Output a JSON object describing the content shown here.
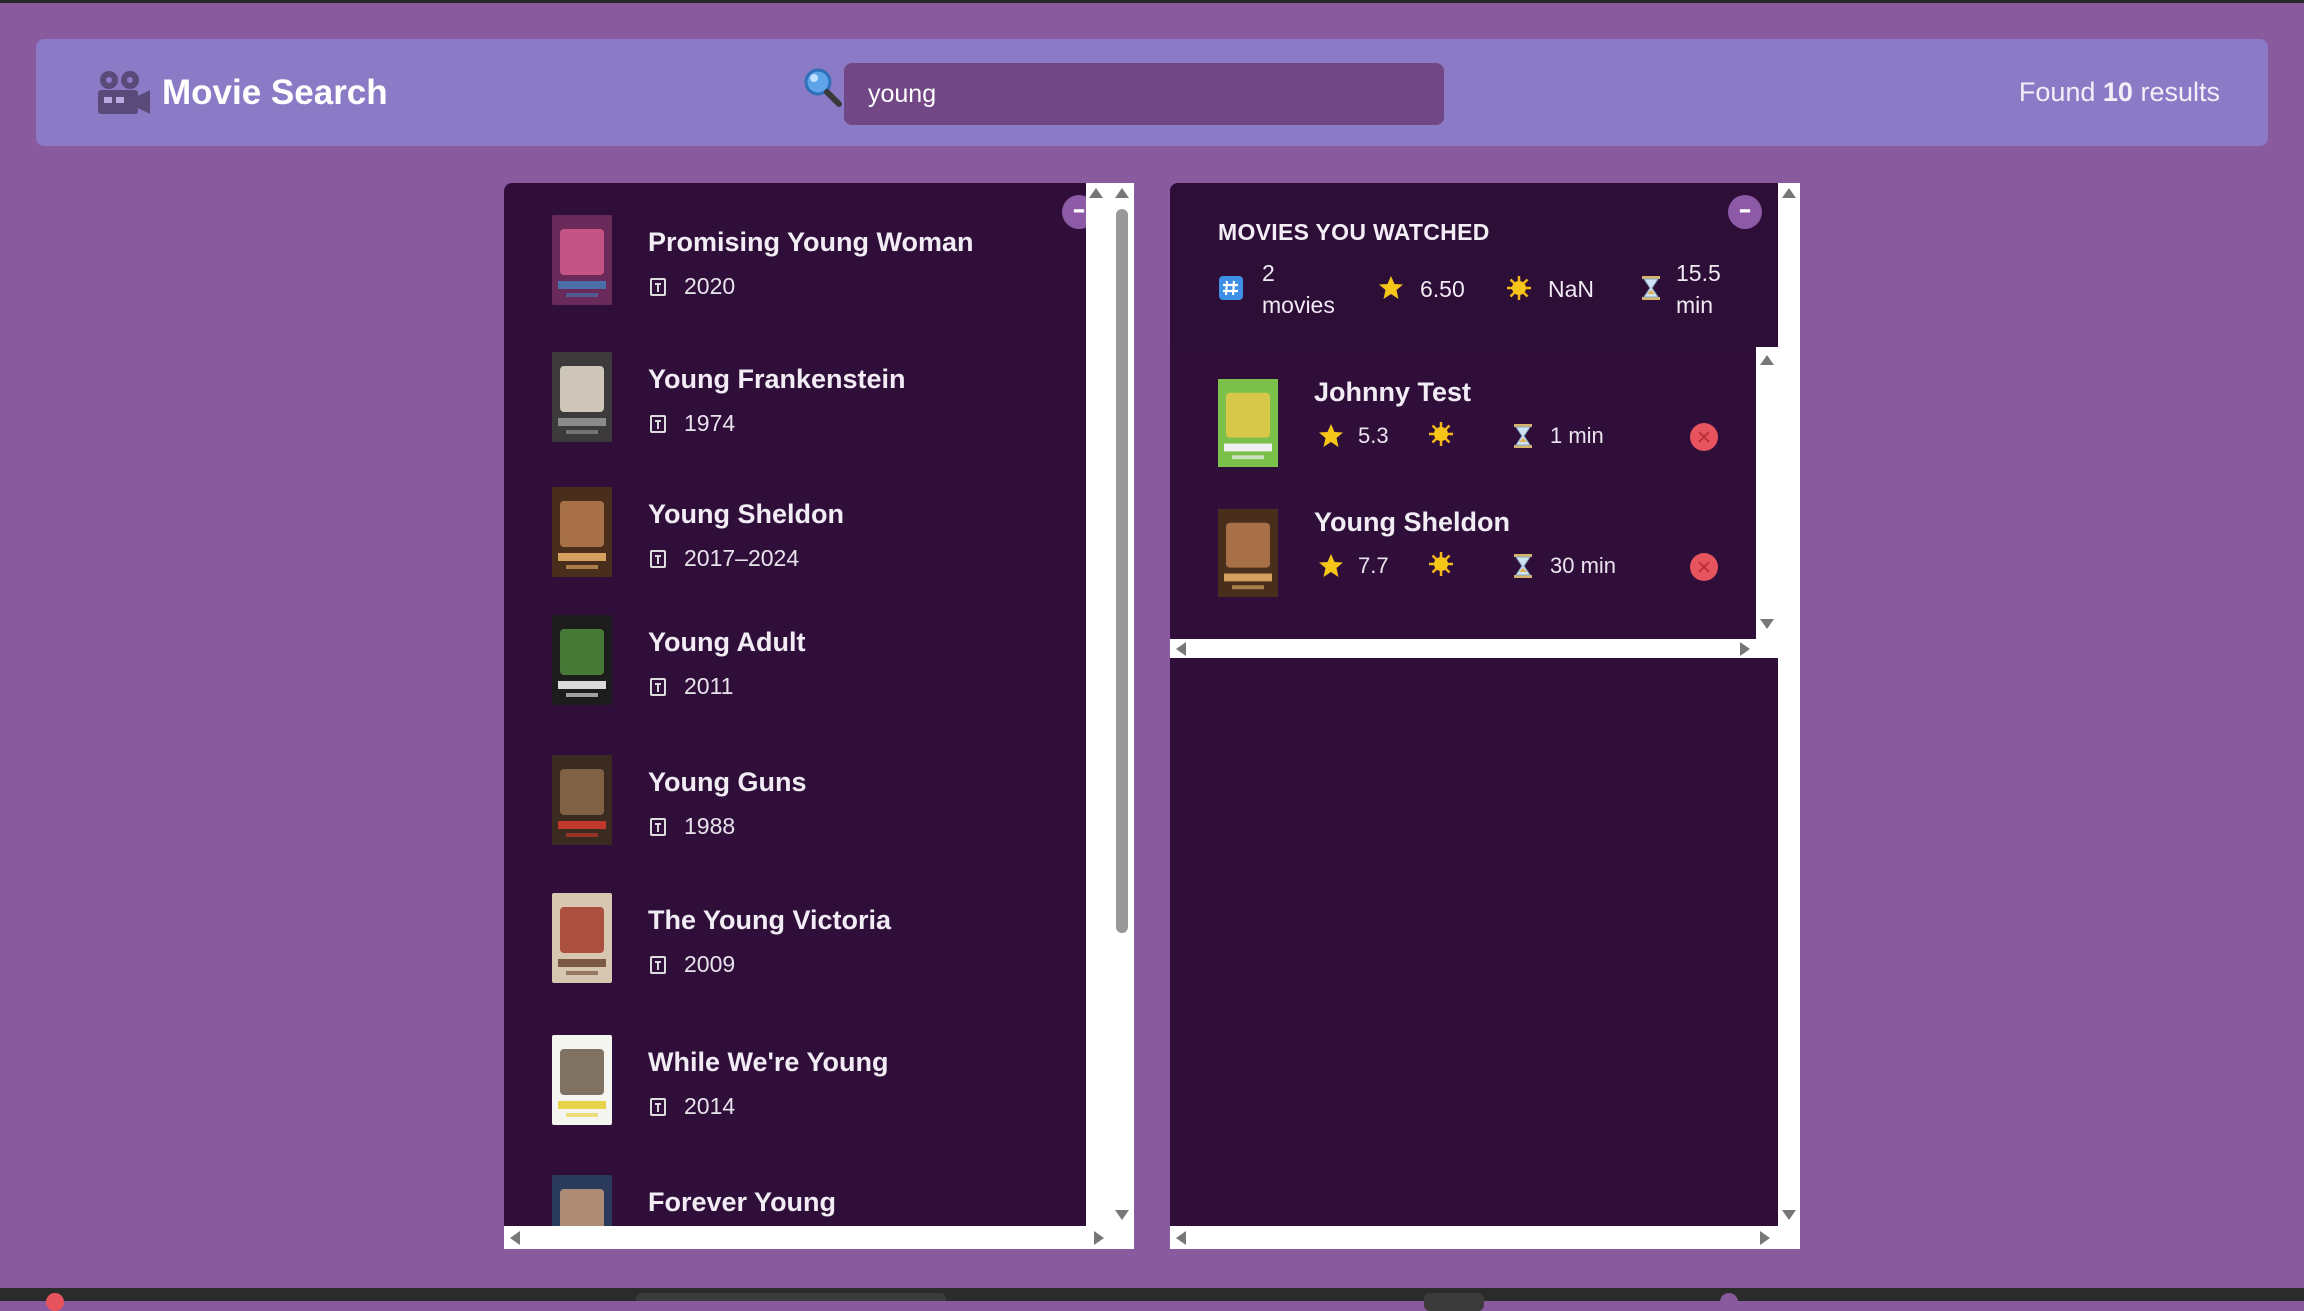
{
  "header": {
    "title": "Movie Search",
    "search_value": "young",
    "results_prefix": "Found",
    "results_count": "10",
    "results_suffix": "results"
  },
  "movies": [
    {
      "title": "Promising Young Woman",
      "year": "2020",
      "poster_colors": [
        "#6b2b5a",
        "#d45c8c",
        "#4a6fa8"
      ]
    },
    {
      "title": "Young Frankenstein",
      "year": "1974",
      "poster_colors": [
        "#3c3a3a",
        "#e8e0d0",
        "#8b8b8b"
      ]
    },
    {
      "title": "Young Sheldon",
      "year": "2017–2024",
      "poster_colors": [
        "#4a2e1c",
        "#b97b4f",
        "#d4a060"
      ]
    },
    {
      "title": "Young Adult",
      "year": "2011",
      "poster_colors": [
        "#1c1c1c",
        "#4c8a3a",
        "#d9d9d9"
      ]
    },
    {
      "title": "Young Guns",
      "year": "1988",
      "poster_colors": [
        "#3a2a1f",
        "#8d6b4a",
        "#c0392b"
      ]
    },
    {
      "title": "The Young Victoria",
      "year": "2009",
      "poster_colors": [
        "#d8c7b0",
        "#a33a2c",
        "#7a5a44"
      ]
    },
    {
      "title": "While We're Young",
      "year": "2014",
      "poster_colors": [
        "#f4f4f0",
        "#6b5a4a",
        "#e8d44a"
      ]
    },
    {
      "title": "Forever Young",
      "year": "",
      "poster_colors": [
        "#2a3a5a",
        "#c49a7a",
        "#8a7060"
      ]
    }
  ],
  "summary": {
    "title": "MOVIES YOU WATCHED",
    "count_line1": "2",
    "count_line2": "movies",
    "imdb_avg": "6.50",
    "user_avg": "NaN",
    "runtime_line1": "15.5",
    "runtime_line2": "min"
  },
  "watched": [
    {
      "title": "Johnny Test",
      "imdb": "5.3",
      "user": "",
      "runtime": "1 min",
      "poster_colors": [
        "#7ac04a",
        "#e8c94a",
        "#f0f0f0"
      ]
    },
    {
      "title": "Young Sheldon",
      "imdb": "7.7",
      "user": "",
      "runtime": "30 min",
      "poster_colors": [
        "#4a2e1c",
        "#b97b4f",
        "#d4a060"
      ]
    }
  ],
  "icons": {
    "logo": "movie-camera-icon",
    "search": "magnifying-glass-icon",
    "year": "calendar-icon",
    "count": "hash-icon",
    "imdb": "star-icon",
    "user": "sun-icon",
    "runtime": "hourglass-icon",
    "toggle": "minus-icon",
    "delete": "close-icon"
  },
  "colors": {
    "background": "#8a5a9f",
    "navbar": "#8b7bc6",
    "panel": "#2f0f3a",
    "input": "#714785",
    "delete": "#e8545d",
    "star": "#f5c518"
  }
}
